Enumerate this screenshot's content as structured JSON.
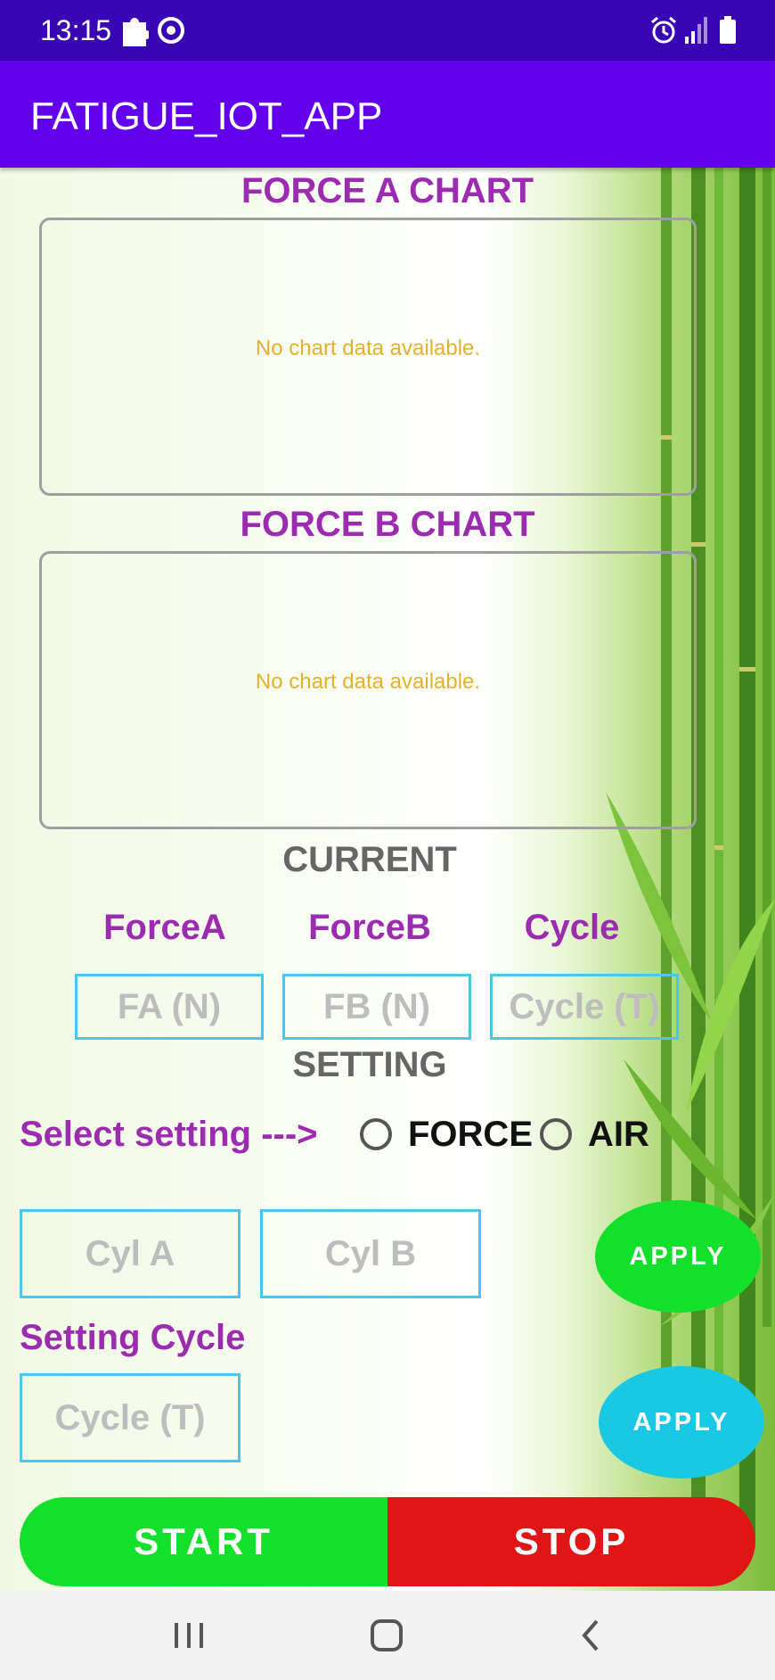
{
  "status_bar": {
    "time": "13:15"
  },
  "app_bar": {
    "title": "FATIGUE_IOT_APP"
  },
  "chart_a": {
    "title": "FORCE A CHART",
    "empty_text": "No chart data available."
  },
  "chart_b": {
    "title": "FORCE B CHART",
    "empty_text": "No chart data available."
  },
  "current": {
    "title": "CURRENT",
    "labels": [
      "ForceA",
      "ForceB",
      "Cycle"
    ],
    "placeholders": [
      "FA (N)",
      "FB (N)",
      "Cycle (T)"
    ]
  },
  "setting": {
    "title": "SETTING",
    "select_label": "Select setting --->",
    "options": [
      "FORCE",
      "AIR"
    ],
    "cyl_a_placeholder": "Cyl A",
    "cyl_b_placeholder": "Cyl B",
    "apply_label": "APPLY",
    "cycle_label": "Setting Cycle",
    "cycle_placeholder": "Cycle (T)",
    "cycle_apply_label": "APPLY"
  },
  "controls": {
    "start_label": "START",
    "stop_label": "STOP"
  },
  "colors": {
    "status_bar": "#3a06b4",
    "app_bar": "#6200ee",
    "label_purple": "#9b2cb0",
    "field_border": "#4cc5ec",
    "apply_green": "#13e02a",
    "apply_cyan": "#19c8e3",
    "start": "#13e02a",
    "stop": "#e01616",
    "no_data": "#e3b12c"
  }
}
